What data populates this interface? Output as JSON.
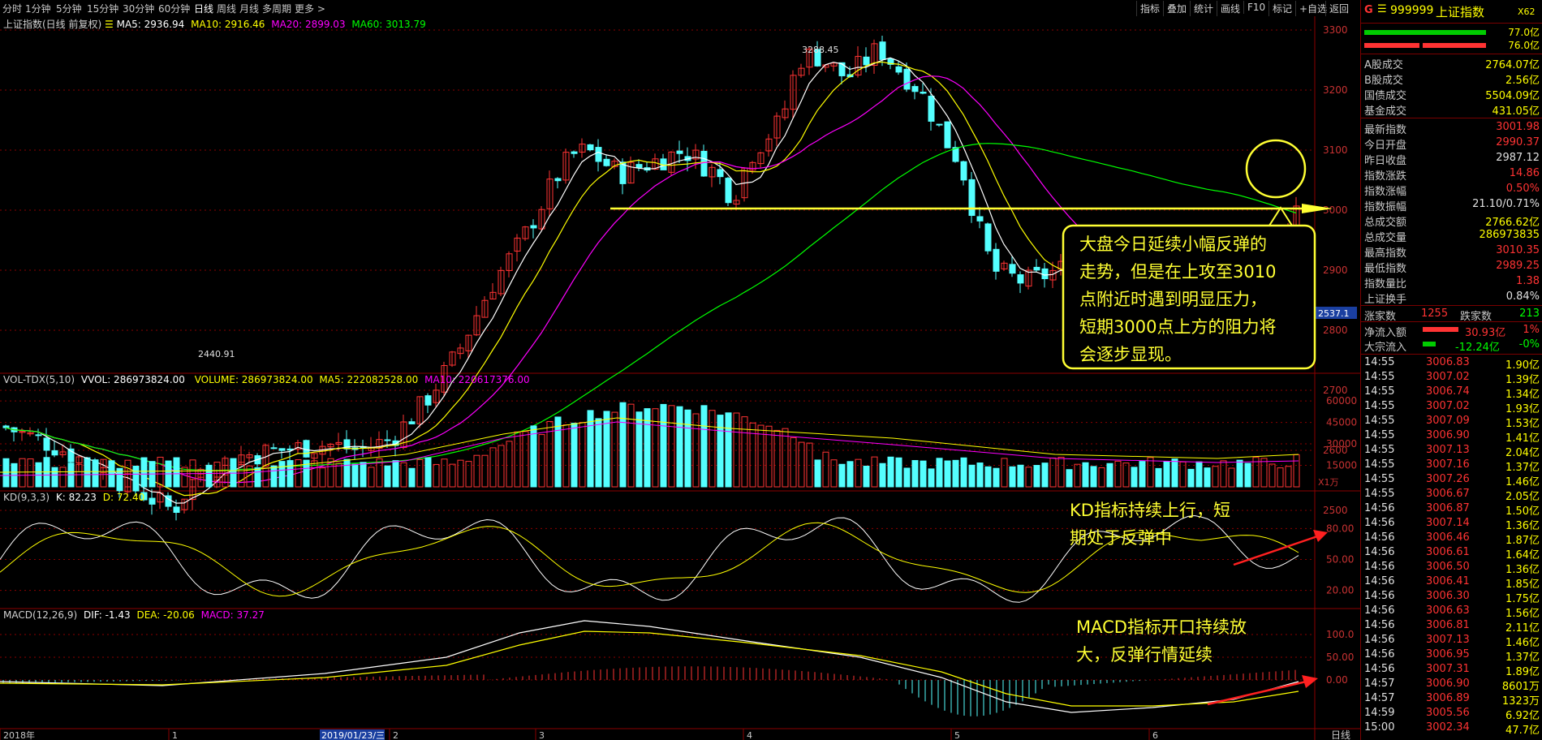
{
  "toolbar": {
    "periods": [
      "分时",
      "1分钟",
      "5分钟",
      "15分钟",
      "30分钟",
      "60分钟",
      "日线",
      "周线",
      "月线",
      "多周期",
      "更多 >"
    ],
    "active_period": "日线",
    "right_tools": [
      "指标",
      "叠加",
      "统计",
      "画线",
      "F10",
      "标记",
      "+自选",
      "返回"
    ]
  },
  "chart_header": {
    "title": "上证指数(日线 前复权)",
    "ma5": "MA5: 2936.94",
    "ma10": "MA10: 2916.46",
    "ma20": "MA20: 2899.03",
    "ma60": "MA60: 3013.79",
    "high_label": "3288.45",
    "low_label": "2440.91",
    "current_price_tag": "2537.1"
  },
  "price_axis": [
    "3300",
    "3200",
    "3100",
    "3000",
    "2900",
    "2800",
    "2700",
    "2600",
    "2500"
  ],
  "volume_header": {
    "name": "VOL-TDX(5,10)",
    "vvol": "VVOL: 286973824.00",
    "volume": "VOLUME: 286973824.00",
    "ma5": "MA5: 222082528.00",
    "ma10": "MA10: 220617376.00"
  },
  "volume_axis": [
    "60000",
    "45000",
    "30000",
    "15000"
  ],
  "volume_unit": "X1万",
  "kd_header": {
    "name": "KD(9,3,3)",
    "k": "K: 82.23",
    "d": "D: 72.40"
  },
  "kd_axis": [
    "80.00",
    "50.00",
    "20.00"
  ],
  "macd_header": {
    "name": "MACD(12,26,9)",
    "dif": "DIF: -1.43",
    "dea": "DEA: -20.06",
    "macd": "MACD: 37.27"
  },
  "macd_axis": [
    "100.0",
    "50.00",
    "0.00"
  ],
  "date_axis": {
    "labels": [
      "2018年",
      "1",
      "2019/01/23/三",
      "2",
      "3",
      "4",
      "5",
      "6"
    ],
    "right_label": "日线"
  },
  "annotations": {
    "main": [
      "大盘今日延续小幅反弹的",
      "走势，但是在上攻至3010",
      "点附近时遇到明显压力，",
      "短期3000点上方的阻力将",
      "会逐步显现。"
    ],
    "kd": [
      "KD指标持续上行，短",
      "期处于反弹中"
    ],
    "macd": [
      "MACD指标开口持续放",
      "大，反弹行情延续"
    ]
  },
  "quote": {
    "code_prefix": "G",
    "code": "999999",
    "name": "上证指数",
    "tag": "X62",
    "bar_top_value": "77.0亿",
    "bar_bottom_value": "76.0亿",
    "turnover_rows": [
      {
        "label": "A股成交",
        "value": "2764.07亿"
      },
      {
        "label": "B股成交",
        "value": "2.56亿"
      },
      {
        "label": "国债成交",
        "value": "5504.09亿"
      },
      {
        "label": "基金成交",
        "value": "431.05亿"
      }
    ],
    "stats_rows": [
      {
        "label": "最新指数",
        "value": "3001.98",
        "color": "#ff3333"
      },
      {
        "label": "今日开盘",
        "value": "2990.37",
        "color": "#ff3333"
      },
      {
        "label": "昨日收盘",
        "value": "2987.12",
        "color": "#e0e0e0"
      },
      {
        "label": "指数涨跌",
        "value": "14.86",
        "color": "#ff3333"
      },
      {
        "label": "指数涨幅",
        "value": "0.50%",
        "color": "#ff3333"
      },
      {
        "label": "指数振幅",
        "value": "21.10/0.71%",
        "color": "#e0e0e0"
      },
      {
        "label": "总成交额",
        "value": "2766.62亿",
        "color": "#ffff00"
      },
      {
        "label": "总成交量",
        "value": "286973835",
        "color": "#ffff00"
      },
      {
        "label": "最高指数",
        "value": "3010.35",
        "color": "#ff3333"
      },
      {
        "label": "最低指数",
        "value": "2989.25",
        "color": "#ff3333"
      },
      {
        "label": "指数量比",
        "value": "1.38",
        "color": "#ff3333"
      },
      {
        "label": "上证换手",
        "value": "0.84%",
        "color": "#e0e0e0"
      }
    ],
    "up_label": "涨家数",
    "up_value": "1255",
    "down_label": "跌家数",
    "down_value": "213",
    "inflow_label": "净流入额",
    "inflow_value": "30.93亿",
    "inflow_pct": "1%",
    "block_label": "大宗流入",
    "block_value": "-12.24亿",
    "block_pct": "-0%",
    "ticks": [
      {
        "t": "14:55",
        "p": "3006.83",
        "v": "1.90亿"
      },
      {
        "t": "14:55",
        "p": "3007.02",
        "v": "1.39亿"
      },
      {
        "t": "14:55",
        "p": "3006.74",
        "v": "1.34亿"
      },
      {
        "t": "14:55",
        "p": "3007.02",
        "v": "1.93亿"
      },
      {
        "t": "14:55",
        "p": "3007.09",
        "v": "1.53亿"
      },
      {
        "t": "14:55",
        "p": "3006.90",
        "v": "1.41亿"
      },
      {
        "t": "14:55",
        "p": "3007.13",
        "v": "2.04亿"
      },
      {
        "t": "14:55",
        "p": "3007.16",
        "v": "1.37亿"
      },
      {
        "t": "14:55",
        "p": "3007.26",
        "v": "1.46亿"
      },
      {
        "t": "14:55",
        "p": "3006.67",
        "v": "2.05亿"
      },
      {
        "t": "14:56",
        "p": "3006.87",
        "v": "1.50亿"
      },
      {
        "t": "14:56",
        "p": "3007.14",
        "v": "1.36亿"
      },
      {
        "t": "14:56",
        "p": "3006.46",
        "v": "1.87亿"
      },
      {
        "t": "14:56",
        "p": "3006.61",
        "v": "1.64亿"
      },
      {
        "t": "14:56",
        "p": "3006.50",
        "v": "1.36亿"
      },
      {
        "t": "14:56",
        "p": "3006.41",
        "v": "1.85亿"
      },
      {
        "t": "14:56",
        "p": "3006.30",
        "v": "1.75亿"
      },
      {
        "t": "14:56",
        "p": "3006.63",
        "v": "1.56亿"
      },
      {
        "t": "14:56",
        "p": "3006.81",
        "v": "2.11亿"
      },
      {
        "t": "14:56",
        "p": "3007.13",
        "v": "1.46亿"
      },
      {
        "t": "14:56",
        "p": "3006.95",
        "v": "1.37亿"
      },
      {
        "t": "14:56",
        "p": "3007.31",
        "v": "1.89亿"
      },
      {
        "t": "14:57",
        "p": "3006.90",
        "v": "8601万"
      },
      {
        "t": "14:57",
        "p": "3006.89",
        "v": "1323万"
      },
      {
        "t": "14:59",
        "p": "3005.56",
        "v": "6.92亿"
      },
      {
        "t": "15:00",
        "p": "3002.34",
        "v": "47.7亿"
      }
    ]
  },
  "colors": {
    "up": "#ff3333",
    "down": "#54ffff",
    "ma5": "#ffffff",
    "ma10": "#ffff00",
    "ma20": "#ff00ff",
    "ma60": "#00ff00",
    "grid": "#8b0000",
    "annotation": "#ffff33"
  }
}
